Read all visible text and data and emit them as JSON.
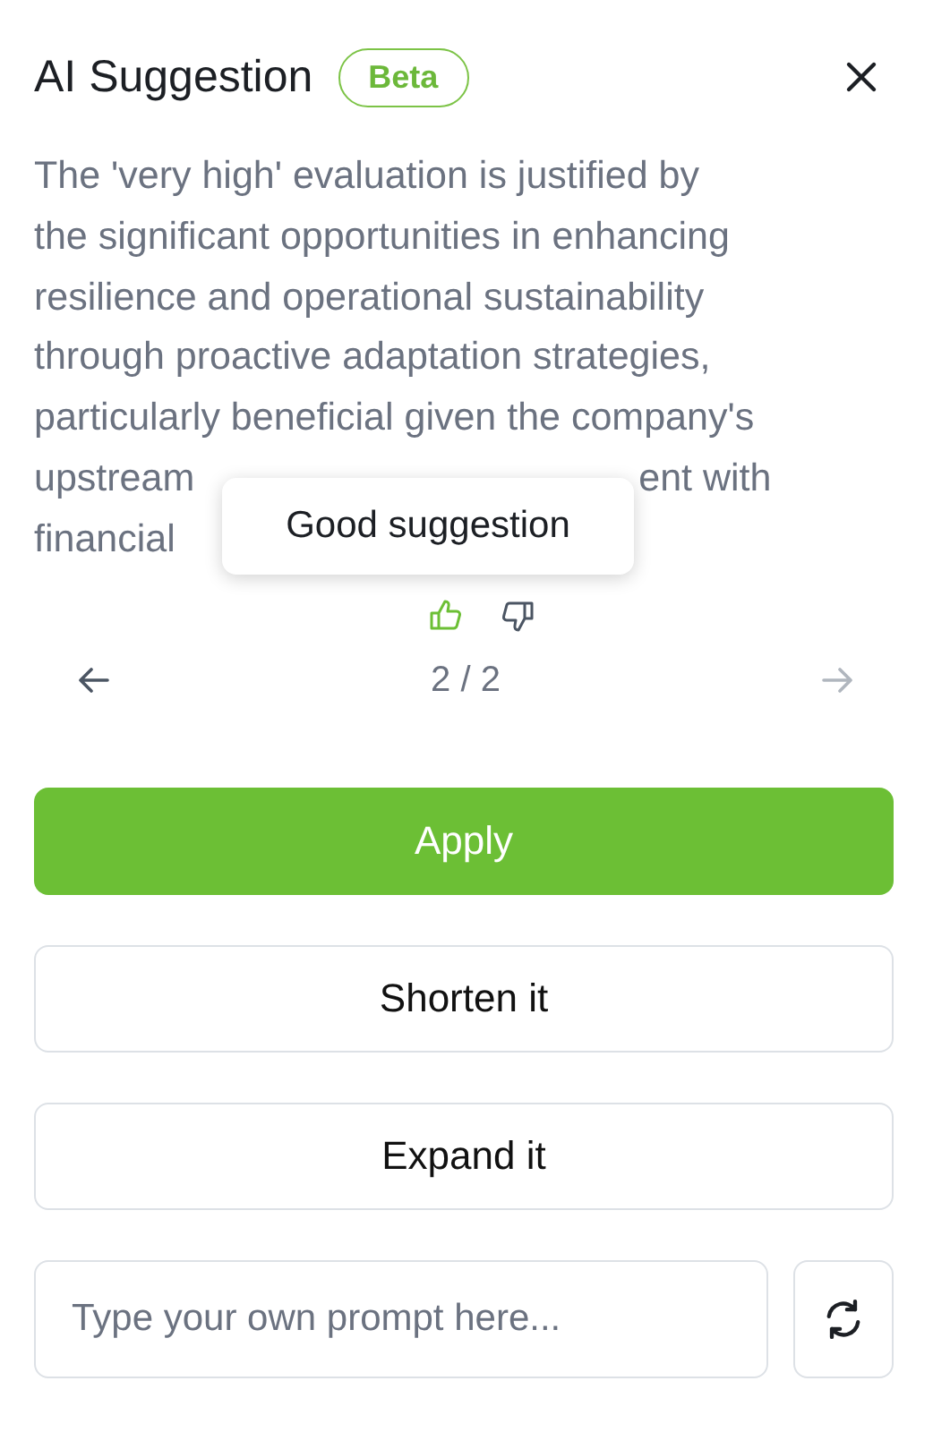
{
  "header": {
    "title": "AI Suggestion",
    "badge": "Beta"
  },
  "suggestion": {
    "lines": [
      {
        "segments": [
          "The 'very high' evaluation is justified by"
        ]
      },
      {
        "segments": [
          "the significant opportunities in enhancing"
        ]
      },
      {
        "segments": [
          "resilience and operational sustainability"
        ]
      },
      {
        "segments": [
          "through proactive adaptation strategies,"
        ]
      },
      {
        "segments": [
          "particularly beneficial given the company's"
        ]
      },
      {
        "segments": [
          "upstream",
          "ent with"
        ]
      },
      {
        "segments": [
          "financial"
        ]
      }
    ]
  },
  "tooltip": "Good suggestion",
  "feedback": [
    {
      "kind": "up",
      "selected": true
    },
    {
      "kind": "down",
      "selected": false
    }
  ],
  "pager": {
    "text": "2 / 2",
    "prev_disabled": false,
    "next_disabled": true
  },
  "actions": [
    {
      "label": "Apply",
      "kind": "primary"
    },
    {
      "label": "Shorten it",
      "kind": "secondary"
    },
    {
      "label": "Expand it",
      "kind": "secondary"
    }
  ],
  "prompt": {
    "placeholder": "Type your own prompt here..."
  }
}
